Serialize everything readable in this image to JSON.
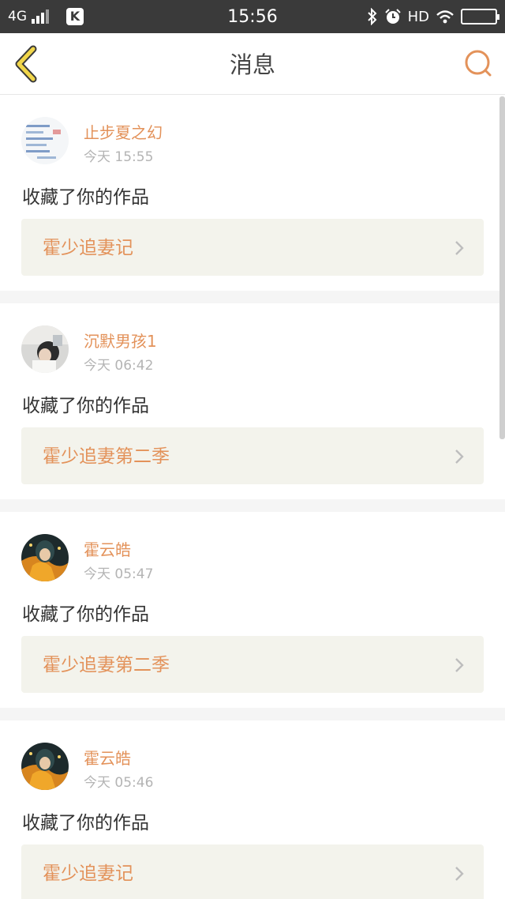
{
  "status_bar": {
    "network": "4G",
    "time": "15:56",
    "hd": "HD",
    "icons": [
      "signal-icon",
      "k-app-icon",
      "bluetooth-icon",
      "alarm-icon",
      "wifi-icon",
      "battery-icon"
    ]
  },
  "header": {
    "title": "消息",
    "back_icon": "chevron-left-icon",
    "search_icon": "search-icon"
  },
  "colors": {
    "accent": "#e3925a",
    "back_icon": "#f1d64a",
    "status_bar_bg": "#3a3a3a",
    "link_bg": "#f3f3ec"
  },
  "messages": [
    {
      "user": "止步夏之幻",
      "time": "今天 15:55",
      "action": "收藏了你的作品",
      "work": "霍少追妻记"
    },
    {
      "user": "沉默男孩1",
      "time": "今天 06:42",
      "action": "收藏了你的作品",
      "work": "霍少追妻第二季"
    },
    {
      "user": "霍云皓",
      "time": "今天 05:47",
      "action": "收藏了你的作品",
      "work": "霍少追妻第二季"
    },
    {
      "user": "霍云皓",
      "time": "今天 05:46",
      "action": "收藏了你的作品",
      "work": "霍少追妻记"
    }
  ]
}
